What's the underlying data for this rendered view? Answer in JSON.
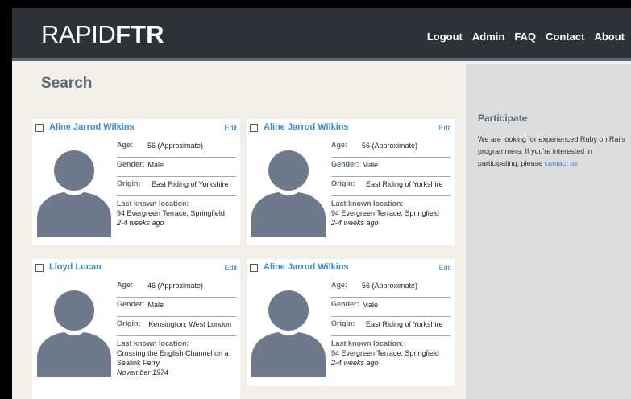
{
  "logo": {
    "thin": "RAPID",
    "bold": "FTR"
  },
  "nav": {
    "logout": "Logout",
    "admin": "Admin",
    "faq": "FAQ",
    "contact": "Contact",
    "about": "About"
  },
  "page_title": "Search",
  "labels": {
    "age": "Age:",
    "gender": "Gender:",
    "origin": "Origin:",
    "last_known_location": "Last known location:",
    "edit": "Edit"
  },
  "sidebar": {
    "title": "Participate",
    "text": "We are looking for experienced Ruby on Rails programmers. If you're interested in participating, please ",
    "link": "contact us"
  },
  "results": [
    {
      "name": "Aline Jarrod Wilkins",
      "age": "56 (Approximate)",
      "gender": "Male",
      "origin": "East Riding of Yorkshire",
      "location": "94 Evergreen Terrace, Springfield",
      "when": "2-4 weeks ago"
    },
    {
      "name": "Aline Jarrod Wilkins",
      "age": "56 (Approximate)",
      "gender": "Male",
      "origin": "East Riding of Yorkshire",
      "location": "94 Evergreen Terrace, Springfield",
      "when": "2-4 weeks ago"
    },
    {
      "name": "Lloyd Lucan",
      "age": "46 (Approximate)",
      "gender": "Male",
      "origin": "Kensington, West London",
      "location": "Crossing the English Channel on a Sealink Ferry",
      "when": "November 1974"
    },
    {
      "name": "Aline Jarrod Wilkins",
      "age": "56 (Approximate)",
      "gender": "Male",
      "origin": "East Riding of Yorkshire",
      "location": "94 Evergreen Terrace, Springfield",
      "when": "2-4 weeks ago"
    }
  ],
  "colors": {
    "header_bg": "#2e3237",
    "page_bg": "#f2efe9",
    "sidebar_bg": "#dddddd",
    "link": "#3c89d6",
    "label": "#5a6876",
    "avatar": "#6e7a8c"
  },
  "icons": {
    "avatar": "person-silhouette-icon",
    "checkbox": "checkbox-icon"
  }
}
